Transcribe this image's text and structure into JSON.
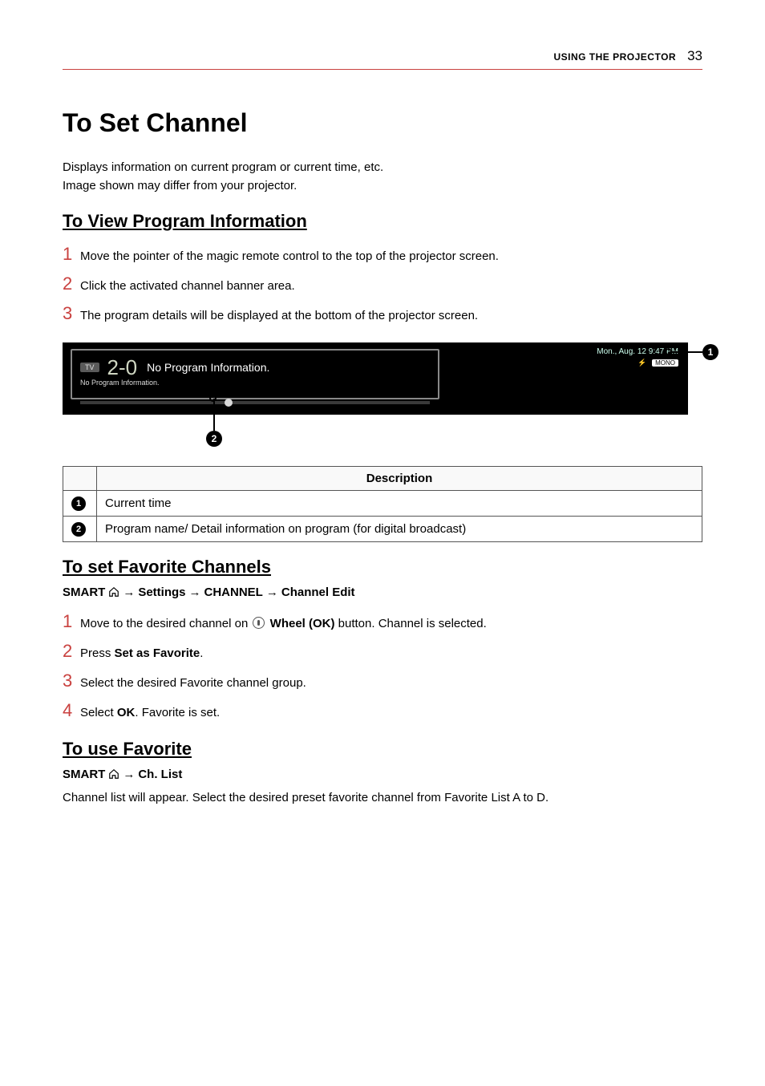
{
  "header": {
    "section": "USING THE PROJECTOR",
    "page_number": "33"
  },
  "title": "To Set Channel",
  "intro_line1": "Displays information on current program or current time, etc.",
  "intro_line2": "Image shown may differ from your projector.",
  "view_info": {
    "heading": "To View Program Information",
    "steps": [
      "Move the pointer of the magic remote control to the top of the projector screen.",
      "Click the activated channel banner area.",
      "The program details will be displayed at the bottom of the projector screen."
    ]
  },
  "screenshot": {
    "tv_badge": "TV",
    "channel_num": "2-0",
    "no_prog_main": "No Program Information.",
    "no_prog_sub": "No Program Information.",
    "date_time": "Mon., Aug. 12  9:47 PM",
    "mono": "MONO",
    "callout_1": "1",
    "callout_2": "2"
  },
  "desc_table": {
    "header": "Description",
    "rows": [
      {
        "num": "1",
        "text": "Current time"
      },
      {
        "num": "2",
        "text": "Program name/ Detail information on program (for digital broadcast)"
      }
    ]
  },
  "favorite_set": {
    "heading": "To set Favorite Channels",
    "nav": {
      "smart": "SMART",
      "arrow": "→",
      "settings": "Settings",
      "channel": "CHANNEL",
      "edit": "Channel Edit"
    },
    "step1_pre": "Move to the desired channel on ",
    "step1_bold": "Wheel (OK)",
    "step1_post": " button. Channel is selected.",
    "step2_pre": "Press ",
    "step2_bold": "Set as Favorite",
    "step2_post": ".",
    "step3": "Select the desired Favorite channel group.",
    "step4_pre": "Select ",
    "step4_bold": "OK",
    "step4_post": ". Favorite is set."
  },
  "favorite_use": {
    "heading": "To use Favorite",
    "nav": {
      "smart": "SMART",
      "arrow": "→",
      "chlist": "Ch. List"
    },
    "body": "Channel list will appear. Select the desired preset favorite channel from Favorite List A to D."
  },
  "step_numbers": {
    "n1": "1",
    "n2": "2",
    "n3": "3",
    "n4": "4"
  }
}
